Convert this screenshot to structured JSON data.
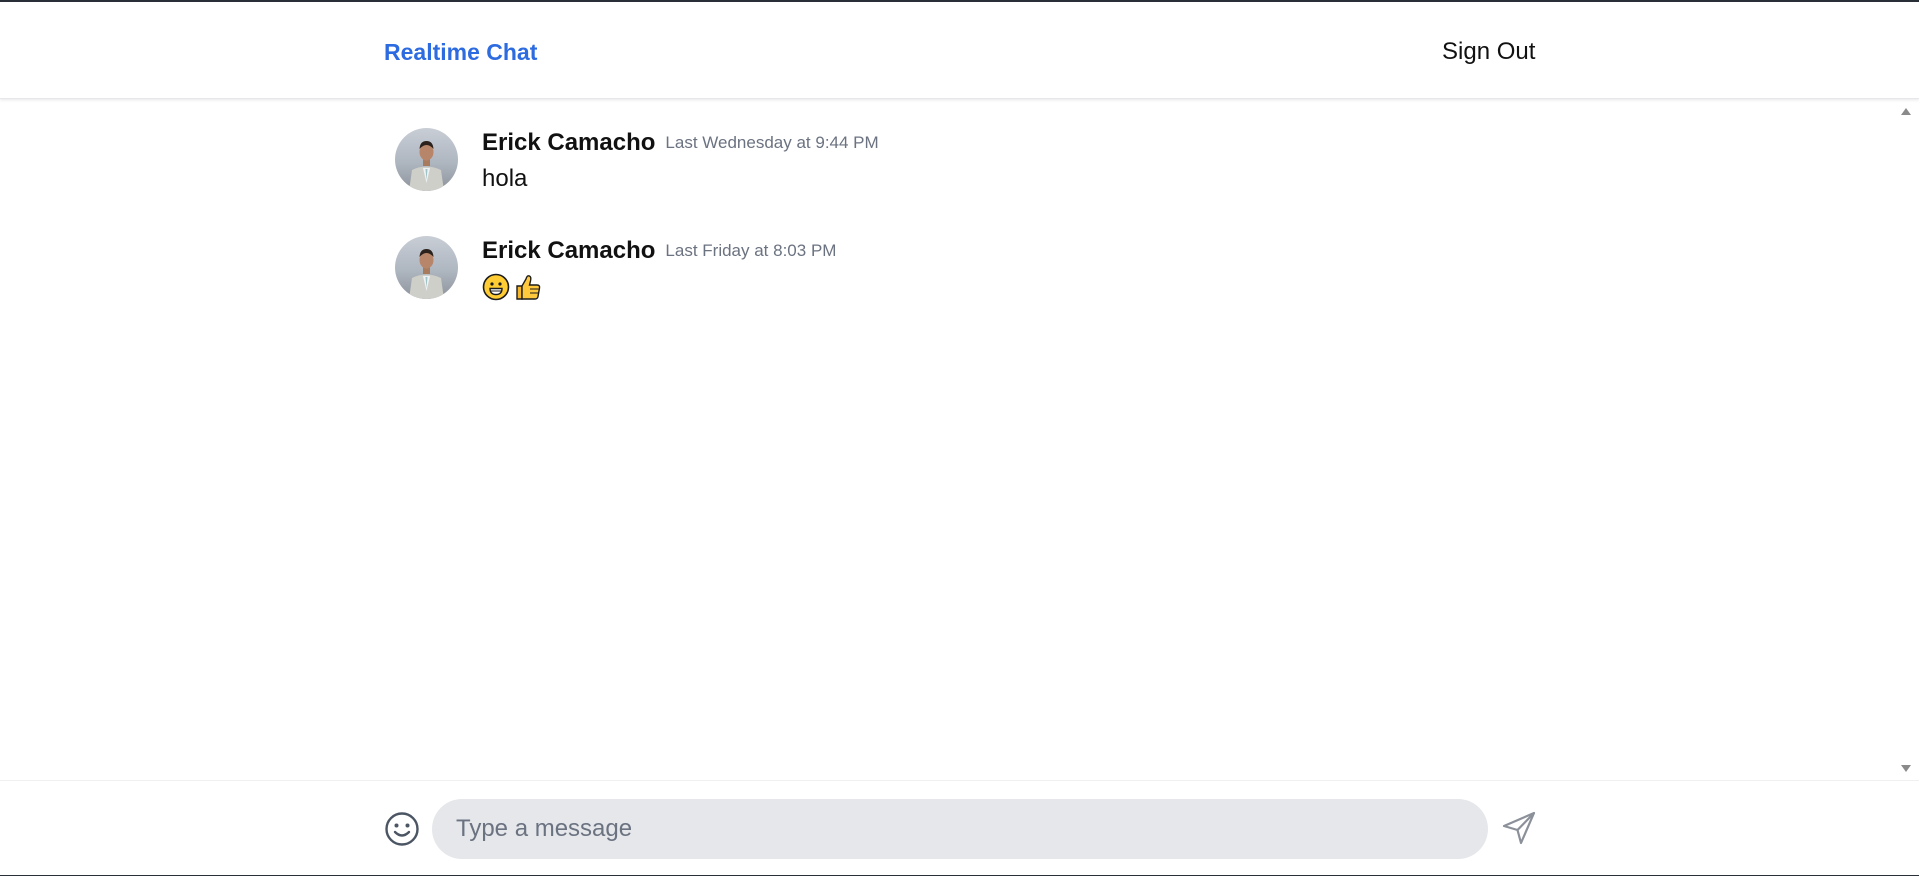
{
  "header": {
    "brand": "Realtime Chat",
    "sign_out_label": "Sign Out"
  },
  "messages": [
    {
      "author": "Erick Camacho",
      "timestamp": "Last Wednesday at 9:44 PM",
      "text": "hola"
    },
    {
      "author": "Erick Camacho",
      "timestamp": "Last Friday at 8:03 PM",
      "emojis": [
        "grinning-face",
        "thumbs-up"
      ]
    }
  ],
  "composer": {
    "placeholder": "Type a message",
    "value": ""
  },
  "colors": {
    "brand": "#2d6be0",
    "input_bg": "#e5e7eb",
    "timestamp": "#6b7280"
  }
}
